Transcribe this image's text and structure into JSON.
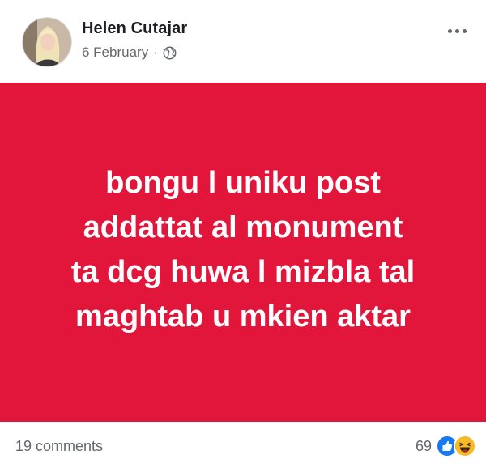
{
  "post": {
    "author": "Helen Cutajar",
    "date": "6 February",
    "separator": "·",
    "privacy_icon": "globe-icon",
    "menu_icon": "more-options-icon",
    "background_color": "#e2153b",
    "text_lines": [
      "bongu l uniku post",
      "addattat al monument",
      "ta dcg huwa l mizbla tal",
      "maghtab u mkien aktar"
    ]
  },
  "footer": {
    "comments_label": "19 comments",
    "reaction_count": "69",
    "reaction_icons": [
      "like-icon",
      "haha-icon"
    ]
  }
}
